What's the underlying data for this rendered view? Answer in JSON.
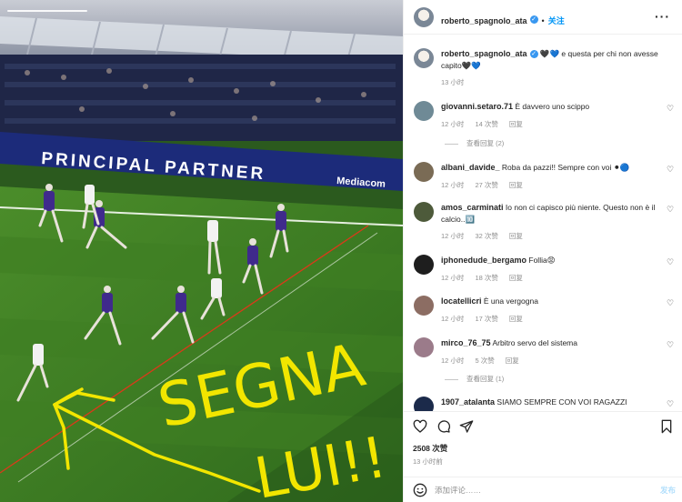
{
  "post": {
    "author": "roberto_spagnolo_ata",
    "follow_label": "关注",
    "more_label": "···",
    "caption_author": "roberto_spagnolo_ata",
    "caption_text": "🖤💙 e questa per chi non avesse capito🖤💙",
    "caption_time": "13 小时",
    "photo_overlay": {
      "banner_text": "PRINCIPAL PARTNER",
      "brand_text": "Mediacom",
      "scribble_line1": "SEGNA",
      "scribble_line2": "LUI!!"
    }
  },
  "comments": [
    {
      "user": "giovanni.setaro.71",
      "text": "È davvero uno scippo",
      "time": "12 小时",
      "likes": "14 次赞",
      "reply": "回复",
      "view_replies": "查看回复 (2)",
      "avatar_color": "#6f8a96"
    },
    {
      "user": "albani_davide_",
      "text": "Roba da pazzi!! Sempre con voi ⚫🔵",
      "time": "12 小时",
      "likes": "27 次赞",
      "reply": "回复",
      "view_replies": "",
      "avatar_color": "#7a6b55"
    },
    {
      "user": "amos_carminati",
      "text": "Io non ci capisco più niente. Questo non è il calcio..🔟",
      "time": "12 小时",
      "likes": "32 次赞",
      "reply": "回复",
      "view_replies": "",
      "avatar_color": "#4d5a3a"
    },
    {
      "user": "iphonedude_bergamo",
      "text": "Follia😡",
      "time": "12 小时",
      "likes": "18 次赞",
      "reply": "回复",
      "view_replies": "",
      "avatar_color": "#1e1e1e"
    },
    {
      "user": "locatellicri",
      "text": "È una vergogna",
      "time": "12 小时",
      "likes": "17 次赞",
      "reply": "回复",
      "view_replies": "",
      "avatar_color": "#8c6d63"
    },
    {
      "user": "mirco_76_75",
      "text": "Arbitro servo del sistema",
      "time": "12 小时",
      "likes": "5 次赞",
      "reply": "回复",
      "view_replies": "查看回复 (1)",
      "avatar_color": "#9b7b8a"
    },
    {
      "user": "1907_atalanta",
      "text": "SIAMO SEMPRE CON VOI RAGAZZI",
      "time": "",
      "likes": "",
      "reply": "",
      "view_replies": "",
      "avatar_color": "#1b2a4a"
    }
  ],
  "footer": {
    "likes": "2508 次赞",
    "ago": "13 小时前",
    "comment_placeholder": "添加评论……",
    "post_label": "发布"
  },
  "icons": {
    "like": "heart-icon",
    "comment": "comment-icon",
    "share": "paper-plane-icon",
    "save": "bookmark-icon",
    "emoji": "smiley-icon"
  },
  "colors": {
    "link_blue": "#0095f6",
    "post_disabled": "#b2dffc",
    "muted": "#8e8e8e",
    "scribble": "#f2e600"
  }
}
